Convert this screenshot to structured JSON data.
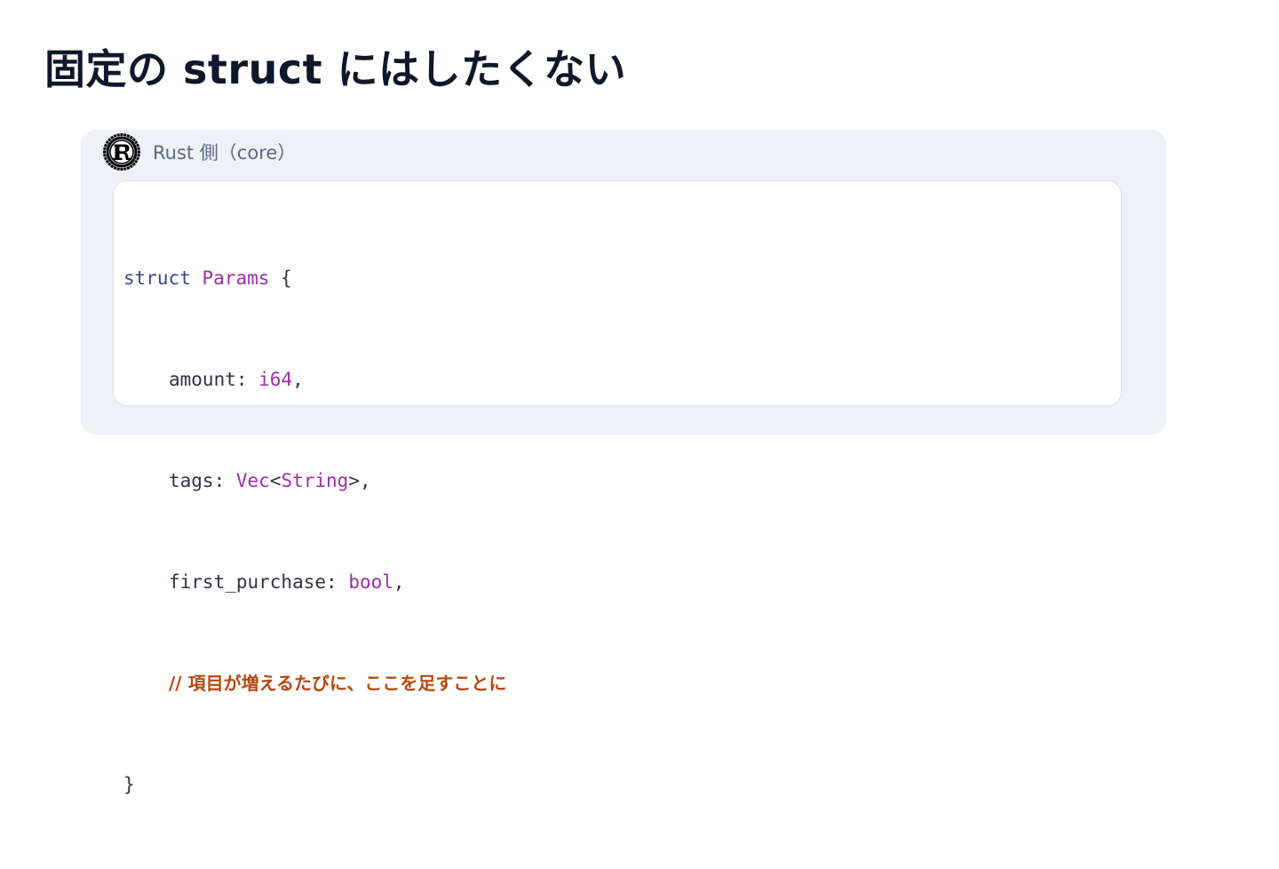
{
  "slide": {
    "title": "固定の struct にはしたくない"
  },
  "panel": {
    "label": "Rust 側（core）",
    "logo_icon": "rust-logo-icon"
  },
  "code": {
    "line1": {
      "keyword": "struct",
      "name": "Params",
      "brace": "{"
    },
    "line2": {
      "field": "amount",
      "colon": ": ",
      "type": "i64",
      "comma": ","
    },
    "line3": {
      "field": "tags",
      "colon": ": ",
      "type_outer": "Vec",
      "lt": "<",
      "type_inner": "String",
      "gt": ">",
      "comma": ","
    },
    "line4": {
      "field": "first_purchase",
      "colon": ": ",
      "type": "bool",
      "comma": ","
    },
    "line5": {
      "comment": "// 項目が増えるたびに、ここを足すことに"
    },
    "line6": {
      "brace": "}"
    }
  },
  "colors": {
    "title": "#0f172a",
    "panel_bg": "#eef1f6",
    "keyword": "#3b4a8c",
    "type": "#9c2fa8",
    "comment": "#b5480f",
    "text": "#2f3542"
  }
}
